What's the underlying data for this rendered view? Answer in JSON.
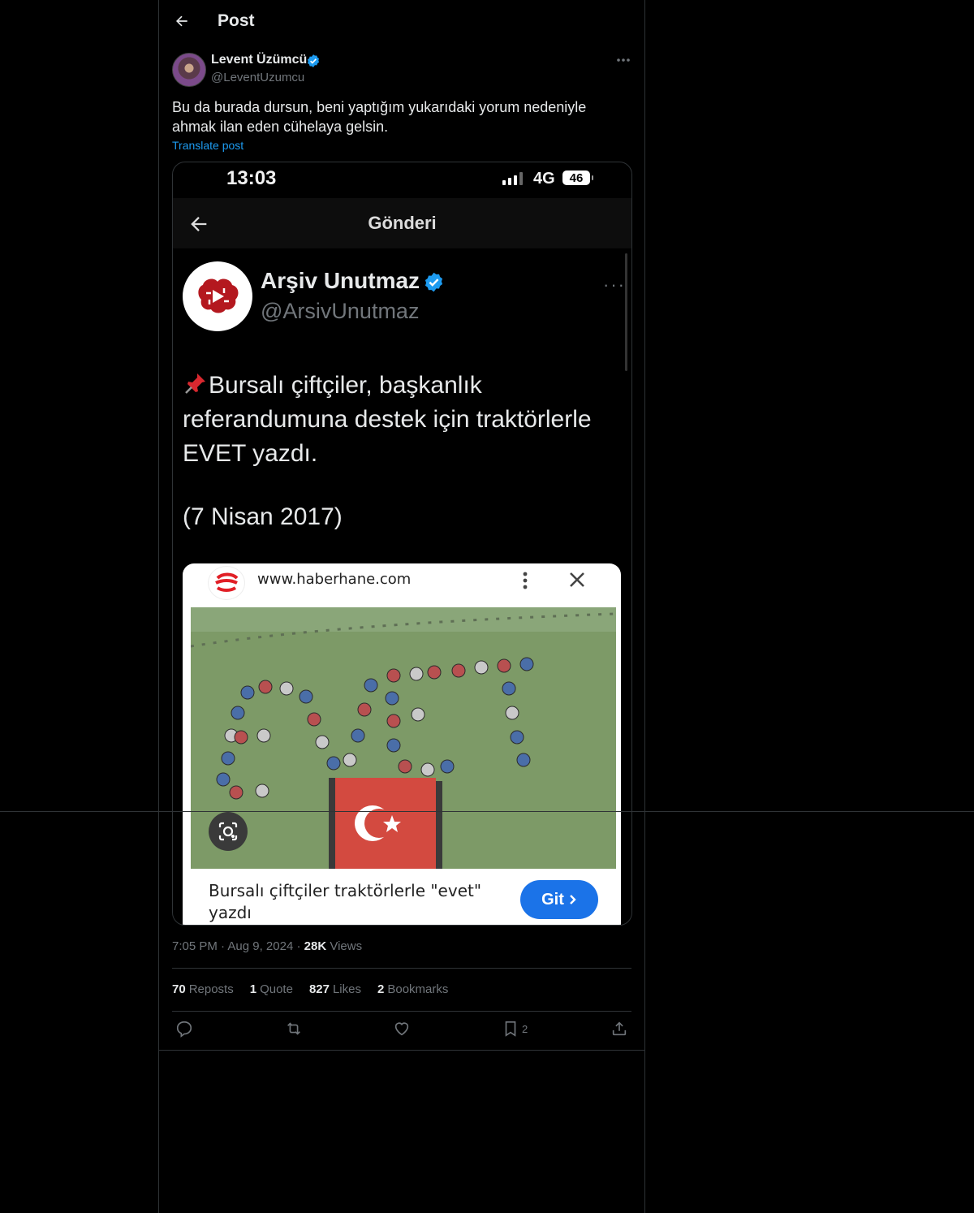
{
  "header": {
    "title": "Post"
  },
  "author": {
    "name": "Levent Üzümcü",
    "handle": "@LeventUzumcu"
  },
  "post": {
    "text": "Bu da burada dursun, beni yaptığım yukarıdaki yorum nedeniyle ahmak ilan eden cühelaya gelsin.",
    "translate_label": "Translate post"
  },
  "screenshot": {
    "status_time": "13:03",
    "network": "4G",
    "battery": "46",
    "app_title": "Gönderi",
    "inner_author": {
      "name": "Arşiv Unutmaz",
      "handle": "@ArsivUnutmaz"
    },
    "inner_text": "Bursalı çiftçiler, başkanlık referandumuna destek için traktörlerle EVET yazdı.",
    "inner_date": "(7 Nisan 2017)",
    "card": {
      "url": "www.haberhane.com",
      "caption": "Bursalı çiftçiler traktörlerle \"evet\" yazdı",
      "button_label": "Git"
    }
  },
  "meta": {
    "time": "7:05 PM",
    "date": "Aug 9, 2024",
    "views_count": "28K",
    "views_label": "Views"
  },
  "stats": {
    "reposts_count": "70",
    "reposts_label": "Reposts",
    "quotes_count": "1",
    "quotes_label": "Quote",
    "likes_count": "827",
    "likes_label": "Likes",
    "bookmarks_count": "2",
    "bookmarks_label": "Bookmarks"
  },
  "actions": {
    "bookmark_count": "2"
  },
  "colors": {
    "background": "#000000",
    "accent": "#1d9bf0",
    "muted": "#71767b",
    "border": "#2f3336"
  }
}
